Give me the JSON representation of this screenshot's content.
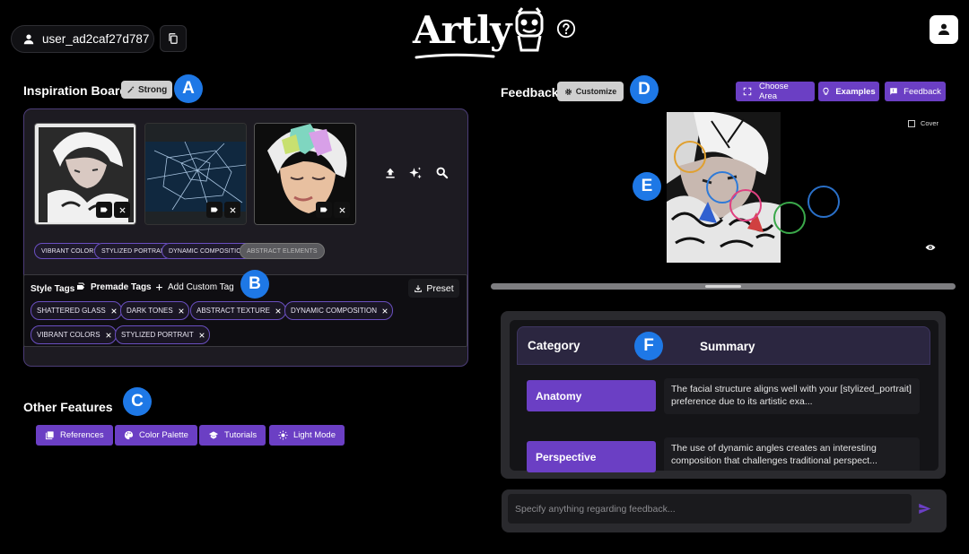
{
  "header": {
    "username": "user_ad2caf27d787",
    "logo_text": "Artly"
  },
  "badges": {
    "a": "A",
    "b": "B",
    "c": "C",
    "d": "D",
    "e": "E",
    "f": "F"
  },
  "inspiration": {
    "title": "Inspiration Board",
    "strength_label": "Strong",
    "preference_tags": [
      "VIBRANT COLORS",
      "STYLIZED PORTRAIT",
      "DYNAMIC COMPOSITION",
      "ABSTRACT ELEMENTS"
    ]
  },
  "style_tags": {
    "label": "Style Tags",
    "premade_label": "Premade Tags",
    "add_custom_label": "Add Custom Tag",
    "preset_label": "Preset",
    "tags": [
      "SHATTERED GLASS",
      "DARK TONES",
      "ABSTRACT TEXTURE",
      "DYNAMIC COMPOSITION",
      "VIBRANT COLORS",
      "STYLIZED PORTRAIT"
    ]
  },
  "other_features": {
    "title": "Other Features",
    "buttons": [
      "References",
      "Color Palette",
      "Tutorials",
      "Light Mode"
    ]
  },
  "feedback": {
    "title": "Feedback",
    "customize_label": "Customize",
    "choose_area_label": "Choose Area",
    "examples_label": "Examples",
    "feedback_label": "Feedback",
    "cover_label": "Cover",
    "input_placeholder": "Specify anything regarding feedback..."
  },
  "summary_table": {
    "col_category": "Category",
    "col_summary": "Summary",
    "rows": [
      {
        "category": "Anatomy",
        "summary": "The facial structure aligns well with your [stylized_portrait] preference due to its artistic exa..."
      },
      {
        "category": "Perspective",
        "summary": "The use of dynamic angles creates an interesting composition that challenges traditional perspect..."
      }
    ]
  },
  "colors": {
    "accent_purple": "#6b3fc4",
    "badge_blue": "#1e78e6",
    "circle_orange": "#e0a030",
    "circle_blue": "#2e7ad8",
    "circle_pink": "#e04080",
    "circle_green": "#3aa84a",
    "circle_navy": "#2a70c8"
  }
}
